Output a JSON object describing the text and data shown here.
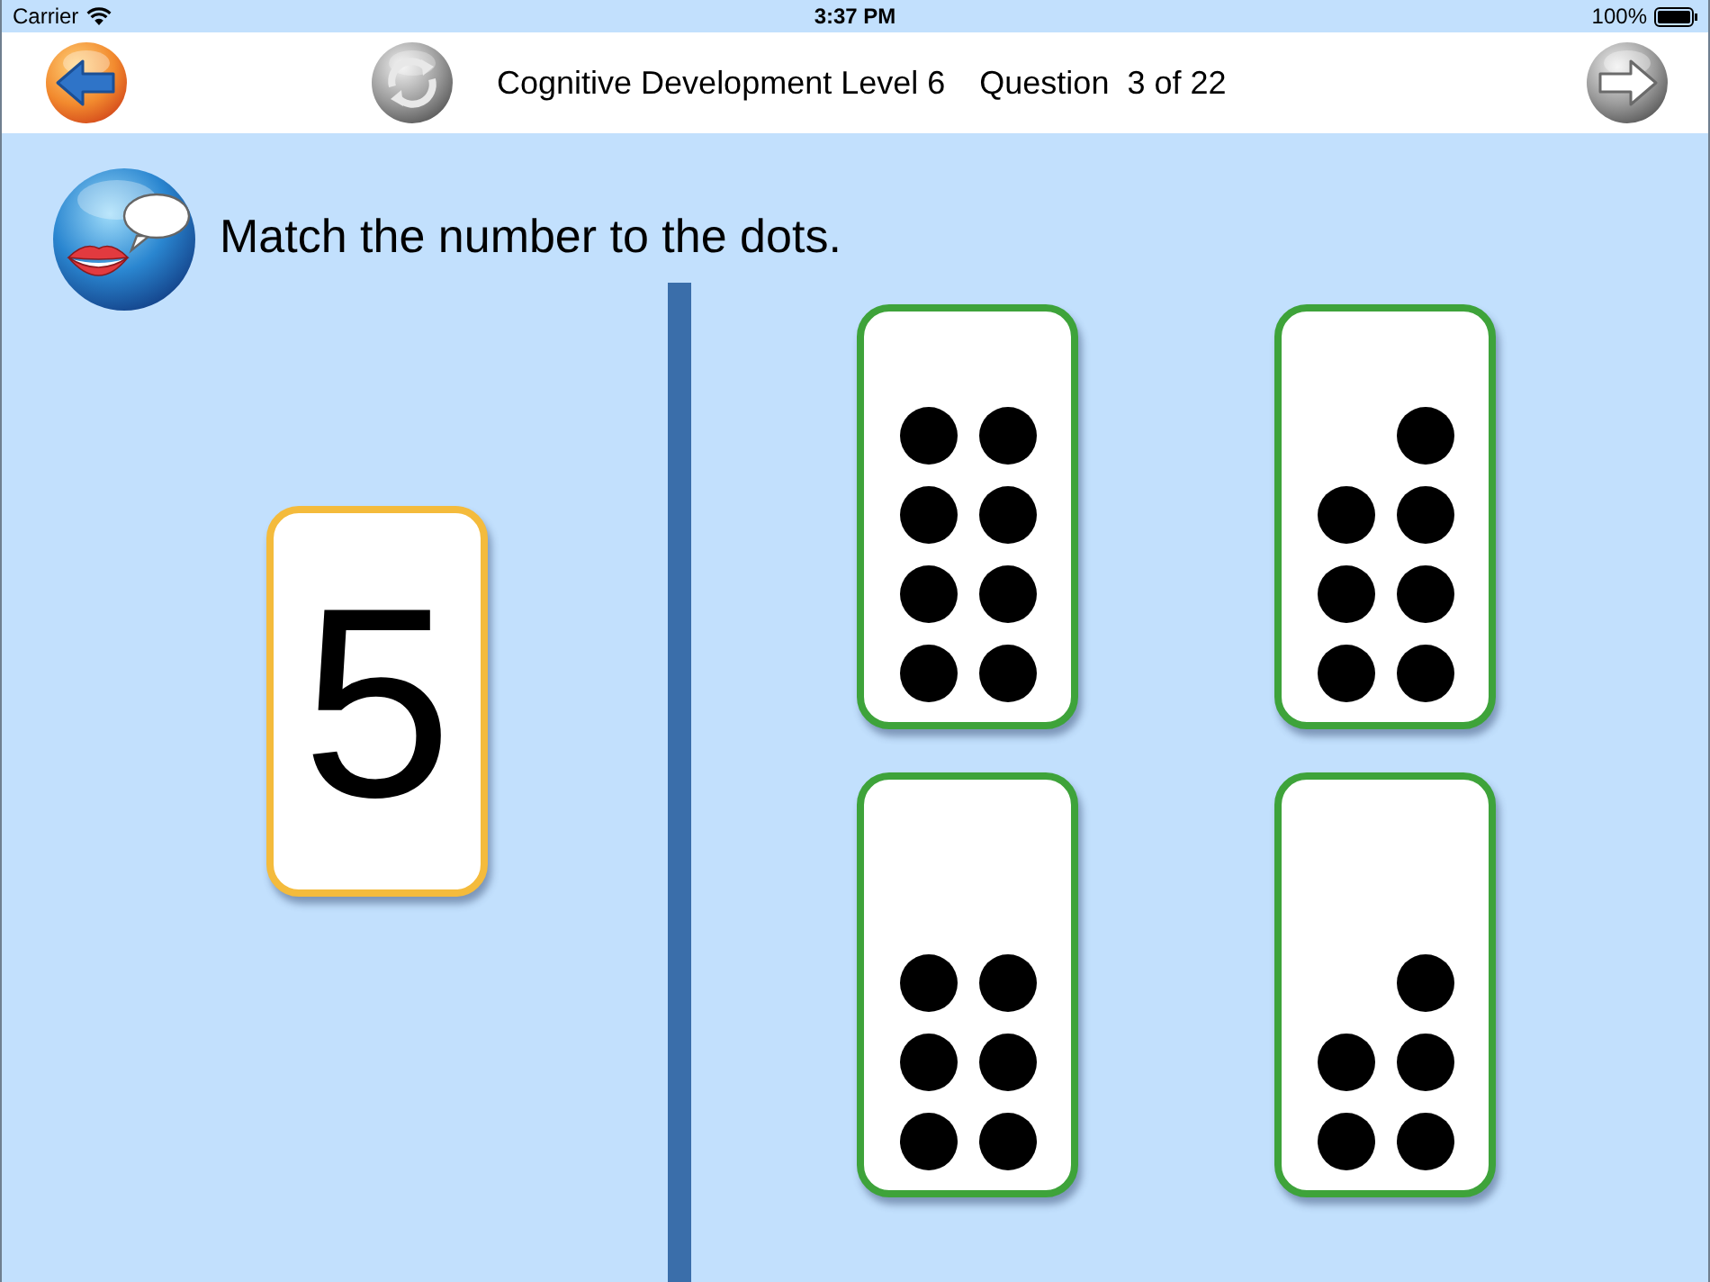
{
  "status_bar": {
    "carrier": "Carrier",
    "time": "3:37 PM",
    "battery": "100%"
  },
  "header": {
    "back_button": {
      "disabled": false
    },
    "replay_button": {
      "disabled": true
    },
    "title": "Cognitive Development Level 6",
    "question_label": "Question",
    "question_number": "3 of 22",
    "next_button": {
      "disabled": true
    }
  },
  "prompt": {
    "text": "Match the number to the dots."
  },
  "number_card": {
    "value": "5"
  },
  "dot_cards": [
    {
      "slots": [
        {
          "filled": true
        },
        {
          "filled": true
        },
        {
          "filled": true
        },
        {
          "filled": true
        },
        {
          "filled": true
        },
        {
          "filled": true
        },
        {
          "filled": true
        },
        {
          "filled": true
        }
      ]
    },
    {
      "slots": [
        {
          "filled": false
        },
        {
          "filled": true
        },
        {
          "filled": true
        },
        {
          "filled": true
        },
        {
          "filled": true
        },
        {
          "filled": true
        },
        {
          "filled": true
        },
        {
          "filled": true
        }
      ]
    },
    {
      "slots": [
        {
          "filled": false
        },
        {
          "filled": false
        },
        {
          "filled": true
        },
        {
          "filled": true
        },
        {
          "filled": true
        },
        {
          "filled": true
        },
        {
          "filled": true
        },
        {
          "filled": true
        }
      ]
    },
    {
      "slots": [
        {
          "filled": false
        },
        {
          "filled": false
        },
        {
          "filled": false
        },
        {
          "filled": true
        },
        {
          "filled": true
        },
        {
          "filled": true
        },
        {
          "filled": true
        },
        {
          "filled": true
        }
      ]
    }
  ]
}
